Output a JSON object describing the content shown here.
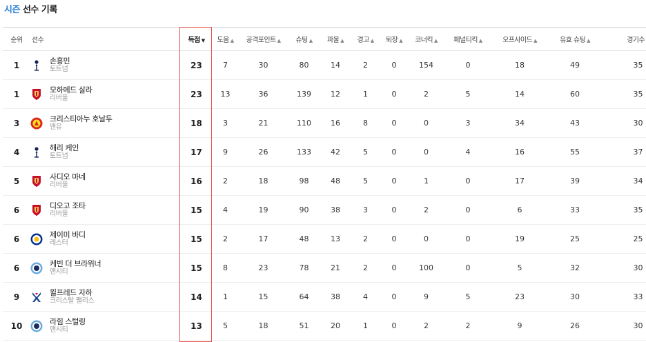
{
  "title": {
    "season": "시즌",
    "rest": "선수 기록"
  },
  "headers": {
    "rank": "순위",
    "player": "선수",
    "goals": "득점",
    "assists": "도움",
    "attack_points": "공격포인트",
    "shots": "슈팅",
    "fouls": "파울",
    "warnings": "경고",
    "red_cards": "퇴장",
    "corners": "코너킥",
    "penalties": "페널티킥",
    "offsides": "오프사이드",
    "shots_on_target": "유효 슈팅",
    "games": "경기수"
  },
  "sort_arrows": {
    "active": "▼",
    "inactive": "▲"
  },
  "team_colors": {
    "tottenham": "#132257",
    "liverpool": "#c8102e",
    "manutd": "#da291c",
    "leicester": "#003090",
    "mancity": "#6cabdd",
    "palace": "#1b458f"
  },
  "rows": [
    {
      "rank": "1",
      "name": "손흥민",
      "team": "토트넘",
      "badge": "tottenham-icon",
      "goals": "23",
      "assists": "7",
      "ap": "30",
      "shots": "80",
      "fouls": "14",
      "warn": "2",
      "red": "0",
      "corner": "154",
      "pk": "0",
      "off": "18",
      "sot": "49",
      "games": "35"
    },
    {
      "rank": "1",
      "name": "모하메드 살라",
      "team": "리버풀",
      "badge": "liverpool-icon",
      "goals": "23",
      "assists": "13",
      "ap": "36",
      "shots": "139",
      "fouls": "12",
      "warn": "1",
      "red": "0",
      "corner": "2",
      "pk": "5",
      "off": "14",
      "sot": "60",
      "games": "35"
    },
    {
      "rank": "3",
      "name": "크리스티아누 호날두",
      "team": "맨유",
      "badge": "manutd-icon",
      "goals": "18",
      "assists": "3",
      "ap": "21",
      "shots": "110",
      "fouls": "16",
      "warn": "8",
      "red": "0",
      "corner": "0",
      "pk": "3",
      "off": "34",
      "sot": "43",
      "games": "30"
    },
    {
      "rank": "4",
      "name": "해리 케인",
      "team": "토트넘",
      "badge": "tottenham-icon",
      "goals": "17",
      "assists": "9",
      "ap": "26",
      "shots": "133",
      "fouls": "42",
      "warn": "5",
      "red": "0",
      "corner": "0",
      "pk": "4",
      "off": "16",
      "sot": "55",
      "games": "37"
    },
    {
      "rank": "5",
      "name": "사디오 마네",
      "team": "리버풀",
      "badge": "liverpool-icon",
      "goals": "16",
      "assists": "2",
      "ap": "18",
      "shots": "98",
      "fouls": "48",
      "warn": "5",
      "red": "0",
      "corner": "1",
      "pk": "0",
      "off": "17",
      "sot": "39",
      "games": "34"
    },
    {
      "rank": "6",
      "name": "디오고 조타",
      "team": "리버풀",
      "badge": "liverpool-icon",
      "goals": "15",
      "assists": "4",
      "ap": "19",
      "shots": "90",
      "fouls": "38",
      "warn": "3",
      "red": "0",
      "corner": "2",
      "pk": "0",
      "off": "6",
      "sot": "33",
      "games": "35"
    },
    {
      "rank": "6",
      "name": "제이미 바디",
      "team": "레스터",
      "badge": "leicester-icon",
      "goals": "15",
      "assists": "2",
      "ap": "17",
      "shots": "48",
      "fouls": "13",
      "warn": "2",
      "red": "0",
      "corner": "0",
      "pk": "0",
      "off": "19",
      "sot": "25",
      "games": "25"
    },
    {
      "rank": "6",
      "name": "케빈 더 브라위너",
      "team": "맨시티",
      "badge": "mancity-icon",
      "goals": "15",
      "assists": "8",
      "ap": "23",
      "shots": "78",
      "fouls": "21",
      "warn": "2",
      "red": "0",
      "corner": "100",
      "pk": "0",
      "off": "5",
      "sot": "32",
      "games": "30"
    },
    {
      "rank": "9",
      "name": "윌프레드 자하",
      "team": "크리스탈 팰리스",
      "badge": "palace-icon",
      "goals": "14",
      "assists": "1",
      "ap": "15",
      "shots": "64",
      "fouls": "38",
      "warn": "4",
      "red": "0",
      "corner": "9",
      "pk": "5",
      "off": "23",
      "sot": "30",
      "games": "33"
    },
    {
      "rank": "10",
      "name": "라힘 스털링",
      "team": "맨시티",
      "badge": "mancity-icon",
      "goals": "13",
      "assists": "5",
      "ap": "18",
      "shots": "51",
      "fouls": "20",
      "warn": "1",
      "red": "0",
      "corner": "2",
      "pk": "2",
      "off": "9",
      "sot": "26",
      "games": "30"
    }
  ]
}
